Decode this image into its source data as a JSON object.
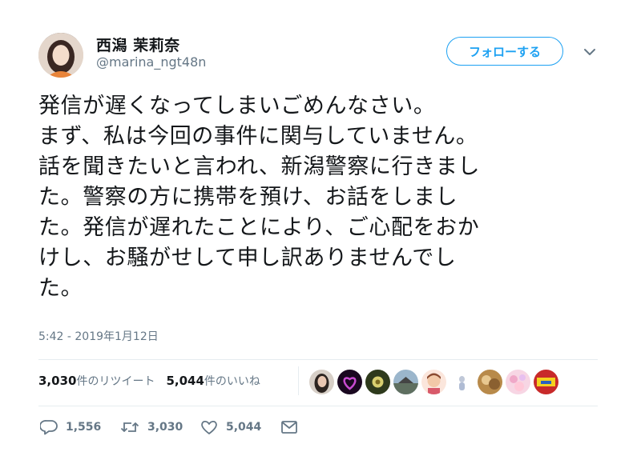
{
  "author": {
    "name": "西潟 茉莉奈",
    "handle": "@marina_ngt48n"
  },
  "follow_button_label": "フォローする",
  "tweet": {
    "lines": [
      "発信が遅くなってしまいごめんなさい。",
      "まず、私は今回の事件に関与していません。",
      "話を聞きたいと言われ、新潟警察に行きまし",
      "た。警察の方に携帯を預け、お話をしまし",
      "た。発信が遅れたことにより、ご心配をおか",
      "けし、お騒がせして申し訳ありませんでし",
      "た。"
    ],
    "timestamp": "5:42 - 2019年1月12日"
  },
  "stats": {
    "retweets_count": "3,030",
    "retweets_label": "件のリツイート",
    "likes_count": "5,044",
    "likes_label": "件のいいね"
  },
  "liker_avatars": [
    {
      "icon": "liker-avatar-1",
      "color": "#3a3330"
    },
    {
      "icon": "liker-avatar-2",
      "color": "#2a1030"
    },
    {
      "icon": "liker-avatar-3",
      "color": "#4a5a2a"
    },
    {
      "icon": "liker-avatar-4",
      "color": "#6f8fa8"
    },
    {
      "icon": "liker-avatar-5",
      "color": "#e8b4a0"
    },
    {
      "icon": "liker-avatar-6",
      "color": "#d8dde8"
    },
    {
      "icon": "liker-avatar-7",
      "color": "#c79a5a"
    },
    {
      "icon": "liker-avatar-8",
      "color": "#f2c4d6"
    },
    {
      "icon": "liker-avatar-9",
      "color": "#c8302a"
    }
  ],
  "actions": {
    "reply_count": "1,556",
    "retweet_count": "3,030",
    "like_count": "5,044"
  },
  "colors": {
    "accent": "#1da1f2",
    "secondary_text": "#657786",
    "divider": "#e6ecf0"
  }
}
